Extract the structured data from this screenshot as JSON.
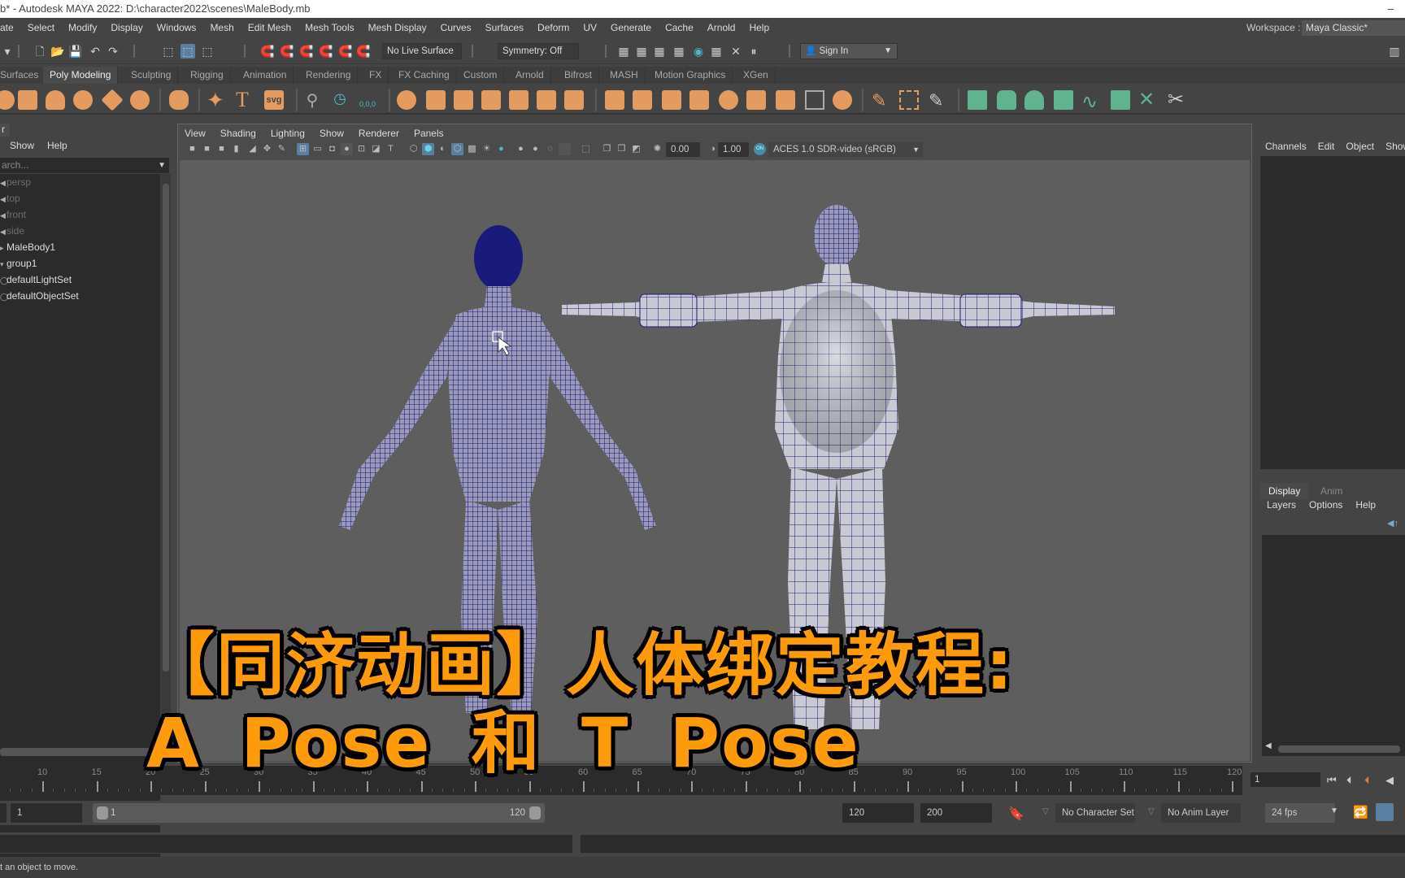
{
  "window": {
    "title": "b* - Autodesk MAYA 2022: D:\\character2022\\scenes\\MaleBody.mb",
    "minimize_glyph": "–"
  },
  "menubar": {
    "items": [
      "ate",
      "Select",
      "Modify",
      "Display",
      "Windows",
      "Mesh",
      "Edit Mesh",
      "Mesh Tools",
      "Mesh Display",
      "Curves",
      "Surfaces",
      "Deform",
      "UV",
      "Generate",
      "Cache",
      "Arnold",
      "Help"
    ],
    "workspace_label": "Workspace :",
    "workspace_value": "Maya Classic*"
  },
  "statusline": {
    "live_surface": "No Live Surface",
    "symmetry": "Symmetry: Off",
    "sign_in": "Sign In"
  },
  "shelf": {
    "tabs": [
      "Surfaces",
      "Poly Modeling",
      "Sculpting",
      "Rigging",
      "Animation",
      "Rendering",
      "FX",
      "FX Caching",
      "Custom",
      "Arnold",
      "Bifrost",
      "MASH",
      "Motion Graphics",
      "XGen"
    ],
    "active_tab": "Poly Modeling",
    "text_icon_label": "T",
    "svg_icon_label": "svg",
    "coord_icon_label": "0,0,0"
  },
  "outliner": {
    "tab_label": "r",
    "menus": [
      "Show",
      "Help"
    ],
    "search_placeholder": "arch...",
    "items": [
      {
        "label": "persp",
        "dim": true,
        "glyph": "◀"
      },
      {
        "label": "top",
        "dim": true,
        "glyph": "◀"
      },
      {
        "label": "front",
        "dim": true,
        "glyph": "◀"
      },
      {
        "label": "side",
        "dim": true,
        "glyph": "◀"
      },
      {
        "label": "MaleBody1",
        "dim": false,
        "glyph": "▸"
      },
      {
        "label": "group1",
        "dim": false,
        "glyph": "▾"
      },
      {
        "label": "defaultLightSet",
        "dim": false,
        "glyph": "◯"
      },
      {
        "label": "defaultObjectSet",
        "dim": false,
        "glyph": "◯"
      }
    ]
  },
  "viewport": {
    "menus": [
      "View",
      "Shading",
      "Lighting",
      "Show",
      "Renderer",
      "Panels"
    ],
    "exposure": "0.00",
    "gamma": "1.00",
    "color_mgmt_badge": "ON",
    "color_space": "ACES 1.0 SDR-video (sRGB)",
    "wire_color": "#1a1a7a",
    "mesh_color": "#c9c9d4",
    "background_color": "#5e5e5e"
  },
  "channel_box": {
    "menus": [
      "Channels",
      "Edit",
      "Object",
      "Show"
    ]
  },
  "layer_editor": {
    "tabs": [
      "Display",
      "Anim"
    ],
    "active_tab": "Display",
    "menus": [
      "Layers",
      "Options",
      "Help"
    ]
  },
  "timeline": {
    "tick_labels": [
      "10",
      "15",
      "20",
      "25",
      "30",
      "35",
      "40",
      "45",
      "50",
      "55",
      "60",
      "65",
      "70",
      "75",
      "80",
      "85",
      "90",
      "95",
      "100",
      "105",
      "110",
      "115",
      "120"
    ],
    "current_frame": "1"
  },
  "range": {
    "start": "1",
    "inner_start": "1",
    "inner_end": "120",
    "end": "120",
    "max_end": "200",
    "character_set": "No Character Set",
    "anim_layer": "No Anim Layer",
    "fps": "24 fps"
  },
  "helpline": {
    "text": "t an object to move."
  },
  "overlay": {
    "line1": "【同济动画】人体绑定教程:",
    "line2": "A Pose 和 T Pose",
    "color": "#ff9a0b"
  }
}
